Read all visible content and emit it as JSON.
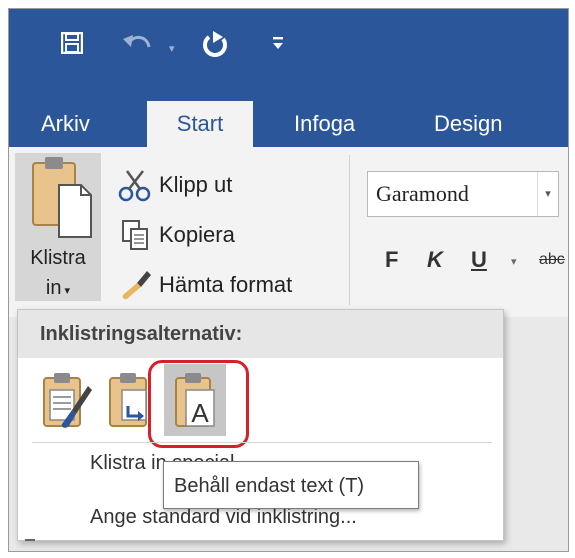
{
  "qat": {
    "save_icon": "save-icon",
    "undo_icon": "undo-icon",
    "redo_icon": "redo-icon",
    "customize_icon": "customize-qat-icon"
  },
  "tabs": [
    {
      "label": "Arkiv",
      "active": false
    },
    {
      "label": "Start",
      "active": true
    },
    {
      "label": "Infoga",
      "active": false
    },
    {
      "label": "Design",
      "active": false
    }
  ],
  "clipboard": {
    "paste_label_line1": "Klistra",
    "paste_label_line2": "in",
    "cut_label": "Klipp ut",
    "copy_label": "Kopiera",
    "format_painter_label": "Hämta format"
  },
  "font": {
    "name": "Garamond",
    "bold": "F",
    "italic": "K",
    "underline": "U",
    "strike": "abc"
  },
  "paste_menu": {
    "header": "Inklistringsalternativ:",
    "options": [
      {
        "icon": "keep-source-formatting-icon"
      },
      {
        "icon": "merge-formatting-icon"
      },
      {
        "icon": "keep-text-only-icon",
        "letter": "A"
      }
    ],
    "items": [
      {
        "label": "Klistra in special..."
      },
      {
        "label": "Ange standard vid inklistring..."
      }
    ]
  },
  "tooltip": "Behåll endast text (T)",
  "colors": {
    "ribbon_blue": "#2b579a",
    "highlight_red": "#d6202a",
    "clipboard_tan": "#e8c48c"
  }
}
